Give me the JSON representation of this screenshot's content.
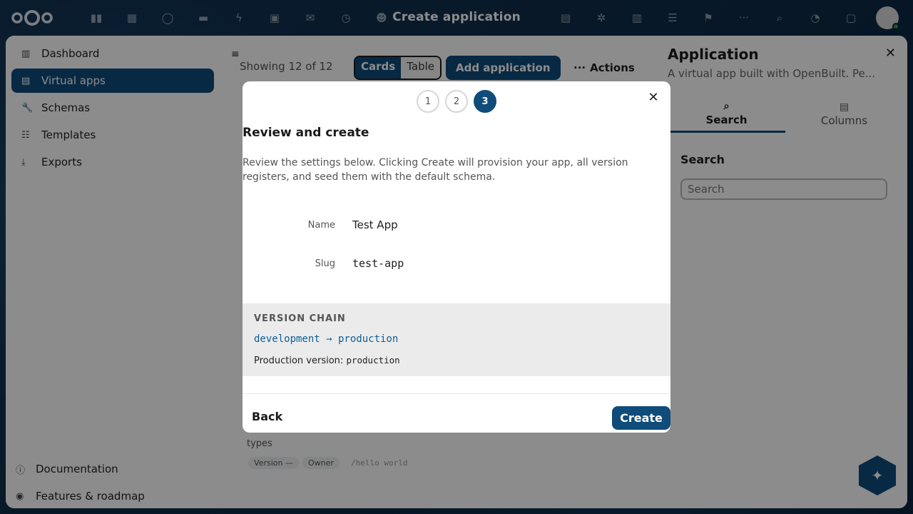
{
  "window": {
    "title": "Create application"
  },
  "topbar": {
    "app_icons": [
      "files-icon",
      "grid-icon",
      "search-circle-icon",
      "folder-icon",
      "bolt-icon",
      "photos-icon",
      "mail-icon",
      "clock-icon",
      "contacts-icon",
      "notes-icon",
      "gear-icon",
      "chart-icon",
      "list-icon",
      "flag-icon",
      "more-icon"
    ],
    "more_label": "···"
  },
  "navigation": {
    "items": [
      {
        "label": "Dashboard",
        "icon": "dashboard-icon",
        "glyph": "▥"
      },
      {
        "label": "Virtual apps",
        "icon": "apps-icon",
        "glyph": "▤"
      },
      {
        "label": "Schemas",
        "icon": "wrench-icon",
        "glyph": "🔧"
      },
      {
        "label": "Templates",
        "icon": "checklist-icon",
        "glyph": "☷"
      },
      {
        "label": "Exports",
        "icon": "download-icon",
        "glyph": "⤓"
      }
    ],
    "footer": [
      {
        "label": "Documentation",
        "icon": "info-icon",
        "glyph": "ⓘ"
      },
      {
        "label": "Features & roadmap",
        "icon": "eye-icon",
        "glyph": "◉"
      }
    ]
  },
  "main": {
    "showing": "Showing 12 of 12",
    "view_toggle": {
      "cards": "Cards",
      "table": "Table"
    },
    "add_button": "Add application",
    "actions_button": "Actions",
    "actions_glyph": "···",
    "card_text": "types",
    "chips": [
      "Version —",
      "Owner"
    ],
    "chip_path": "/hello world"
  },
  "sidebar": {
    "title": "Application",
    "subtitle": "A virtual app built with OpenBuilt. Pe...",
    "tabs": [
      {
        "label": "Search",
        "icon": "search-icon"
      },
      {
        "label": "Columns",
        "icon": "columns-icon"
      }
    ],
    "search_label": "Search",
    "search_placeholder": "Search"
  },
  "modal": {
    "steps": [
      "1",
      "2",
      "3"
    ],
    "active_step": "3",
    "title": "Review and create",
    "description": "Review the settings below. Clicking Create will provision your app, all version registers, and seed them with the default schema.",
    "fields": {
      "name_label": "Name",
      "name_value": "Test App",
      "slug_label": "Slug",
      "slug_value": "test-app"
    },
    "version_chain": {
      "heading": "VERSION CHAIN",
      "chain": "development → production",
      "production_label": "Production version:",
      "production_value": "production"
    },
    "back_label": "Back",
    "create_label": "Create"
  },
  "colors": {
    "primary": "#0f4c7a",
    "link": "#0f5f95"
  }
}
